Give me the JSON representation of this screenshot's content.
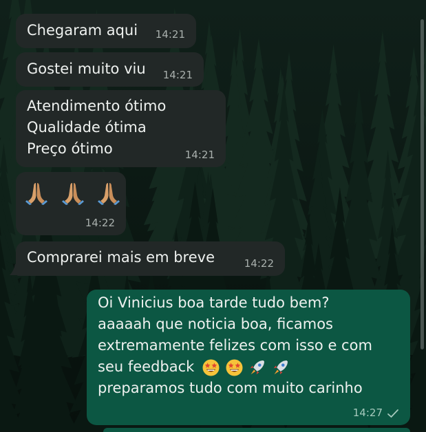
{
  "messages": [
    {
      "text": "Chegaram aqui",
      "time": "14:21"
    },
    {
      "text": "Gostei muito viu",
      "time": "14:21"
    },
    {
      "lines": [
        "Atendimento ótimo",
        "Qualidade ótima",
        "Preço ótimo"
      ],
      "time": "14:21"
    },
    {
      "emoji": "praying-hands-icon",
      "time": "14:22"
    },
    {
      "text": "Comprarei mais em breve",
      "time": "14:22"
    }
  ],
  "reply": {
    "lines": [
      "Oi Vinicius boa tarde tudo bem?",
      "aaaaah que noticia boa, ficamos",
      "extremamente felizes com isso e com",
      "seu feedback",
      "preparamos tudo com muito carinho"
    ],
    "emojis": [
      "star-struck-face-icon",
      "rocket-icon"
    ],
    "time": "14:27",
    "status": "sent-check-icon"
  },
  "colors": {
    "incoming_bubble": "#222827",
    "outgoing_bubble": "#0c5743",
    "background": "#0c1712"
  }
}
